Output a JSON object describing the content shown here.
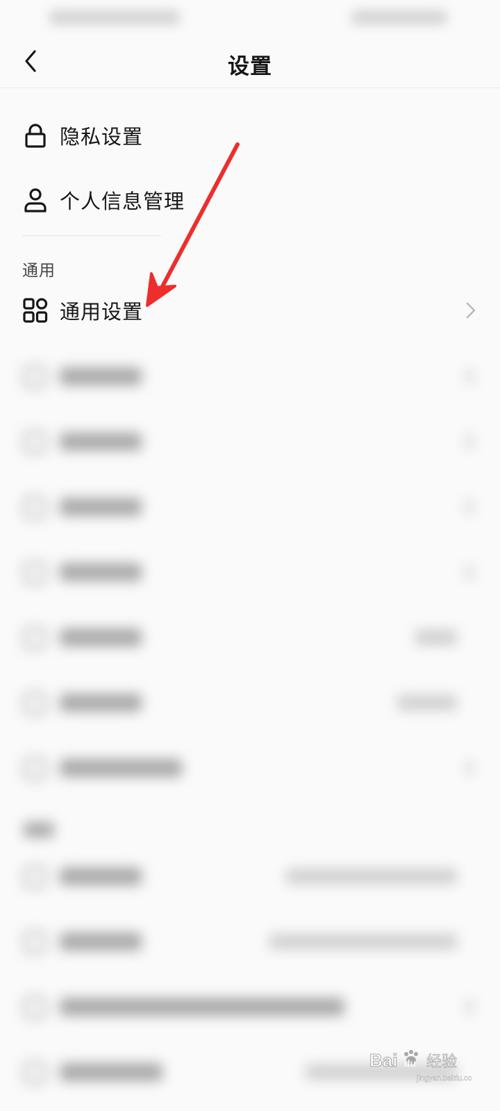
{
  "nav": {
    "title": "设置"
  },
  "account_items": [
    {
      "label": "隐私设置",
      "icon": "lock-icon"
    },
    {
      "label": "个人信息管理",
      "icon": "user-icon"
    }
  ],
  "general_section": {
    "header": "通用",
    "items": [
      {
        "label": "通用设置",
        "icon": "grid-icon",
        "has_chevron": true
      }
    ]
  },
  "annotation": {
    "arrow_color": "#ee2d2d"
  },
  "watermark": {
    "brand": "Baidu 经验",
    "url": "jingyan.baidu.com"
  },
  "colors": {
    "background": "#fafafa",
    "text": "#161616",
    "divider": "#ececec",
    "chevron": "#b9b9b9"
  }
}
